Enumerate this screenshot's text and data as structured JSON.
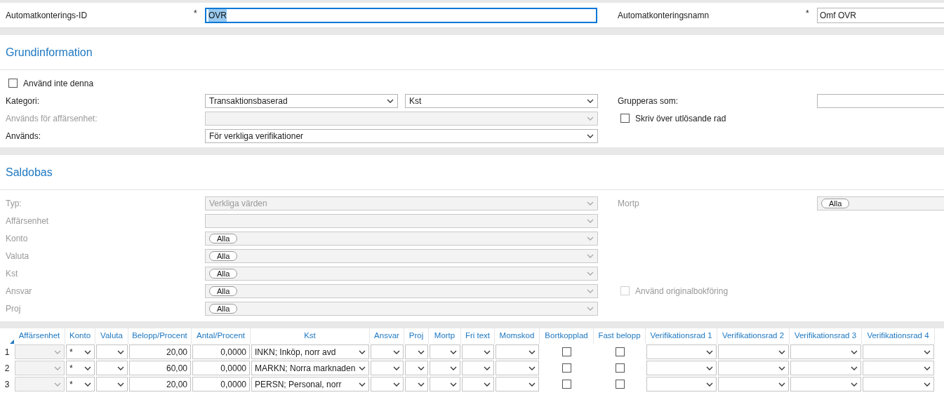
{
  "header": {
    "fields": [
      {
        "label": "Automatkonterings-ID",
        "required": "*",
        "value": "OVR",
        "focused": true
      },
      {
        "label": "Automatkonteringsnamn",
        "required": "*",
        "value": "Omf OVR",
        "focused": false
      }
    ]
  },
  "sections": [
    {
      "title": "Grundinformation",
      "rows": [
        {
          "kind": "checkbox",
          "label": "Använd inte denna",
          "checked": false,
          "disabled": false
        },
        {
          "kind": "selects",
          "label": "Kategori:",
          "disabled": false,
          "selects": [
            {
              "kind": "text",
              "value": "Transaktionsbaserad"
            },
            {
              "kind": "text",
              "value": "Kst"
            }
          ],
          "right": {
            "kind": "input",
            "label": "Grupperas som:",
            "disabled": false
          }
        },
        {
          "kind": "selects",
          "label": "Används för affärsenhet:",
          "disabled": true,
          "selects": [
            {
              "kind": "empty"
            }
          ],
          "right": {
            "kind": "checkbox",
            "label": "Skriv över utlösande rad",
            "checked": false,
            "disabled": false
          }
        },
        {
          "kind": "selects",
          "label": "Används:",
          "disabled": false,
          "selects": [
            {
              "kind": "text",
              "value": "För verkliga verifikationer"
            }
          ]
        }
      ]
    },
    {
      "title": "Saldobas",
      "rows": [
        {
          "kind": "selects",
          "label": "Typ:",
          "disabled": true,
          "selects": [
            {
              "kind": "text",
              "value": "Verkliga värden"
            }
          ],
          "right": {
            "kind": "tags",
            "label": "Mortp",
            "disabled": true,
            "tag": "Alla"
          }
        },
        {
          "kind": "selects",
          "label": "Affärsenhet",
          "disabled": true,
          "selects": [
            {
              "kind": "empty"
            }
          ]
        },
        {
          "kind": "selects",
          "label": "Konto",
          "disabled": true,
          "selects": [
            {
              "kind": "tag",
              "tag": "Alla"
            }
          ]
        },
        {
          "kind": "selects",
          "label": "Valuta",
          "disabled": true,
          "selects": [
            {
              "kind": "tag",
              "tag": "Alla"
            }
          ]
        },
        {
          "kind": "selects",
          "label": "Kst",
          "disabled": true,
          "selects": [
            {
              "kind": "tag",
              "tag": "Alla"
            }
          ]
        },
        {
          "kind": "selects",
          "label": "Ansvar",
          "disabled": true,
          "selects": [
            {
              "kind": "tag",
              "tag": "Alla"
            }
          ],
          "right": {
            "kind": "checkbox",
            "label": "Använd originalbokföring",
            "checked": false,
            "disabled": true
          }
        },
        {
          "kind": "selects",
          "label": "Proj",
          "disabled": true,
          "selects": [
            {
              "kind": "tag",
              "tag": "Alla"
            }
          ]
        }
      ]
    }
  ],
  "table": {
    "columns": [
      {
        "label": "Affärsenhet",
        "kind": "select",
        "disabled": true
      },
      {
        "label": "Konto",
        "kind": "select",
        "disabled": false
      },
      {
        "label": "Valuta",
        "kind": "select",
        "disabled": false
      },
      {
        "label": "Belopp/Procent",
        "kind": "number",
        "disabled": false
      },
      {
        "label": "Antal/Procent",
        "kind": "number",
        "disabled": false
      },
      {
        "label": "Kst",
        "kind": "select",
        "disabled": false
      },
      {
        "label": "Ansvar",
        "kind": "select",
        "disabled": false
      },
      {
        "label": "Proj",
        "kind": "select",
        "disabled": false
      },
      {
        "label": "Mortp",
        "kind": "select",
        "disabled": false
      },
      {
        "label": "Fri text",
        "kind": "select",
        "disabled": false
      },
      {
        "label": "Momskod",
        "kind": "select",
        "disabled": false
      },
      {
        "label": "Bortkopplad",
        "kind": "check",
        "disabled": false
      },
      {
        "label": "Fast belopp",
        "kind": "check",
        "disabled": false
      },
      {
        "label": "Verifikationsrad 1",
        "kind": "select",
        "disabled": false
      },
      {
        "label": "Verifikationsrad 2",
        "kind": "select",
        "disabled": false
      },
      {
        "label": "Verifikationsrad 3",
        "kind": "select",
        "disabled": false
      },
      {
        "label": "Verifikationsrad 4",
        "kind": "select",
        "disabled": false
      }
    ],
    "rows": [
      {
        "number": "1",
        "cells": [
          {},
          {
            "value": "*"
          },
          {},
          {
            "value": "20,00"
          },
          {
            "value": "0,0000"
          },
          {
            "value": "INKN; Inköp, norr avd"
          },
          {},
          {},
          {},
          {},
          {},
          {
            "checked": false
          },
          {
            "checked": false
          },
          {},
          {},
          {},
          {}
        ]
      },
      {
        "number": "2",
        "cells": [
          {},
          {
            "value": "*"
          },
          {},
          {
            "value": "60,00"
          },
          {
            "value": "0,0000"
          },
          {
            "value": "MARKN; Norra marknaden"
          },
          {},
          {},
          {},
          {},
          {},
          {
            "checked": false
          },
          {
            "checked": false
          },
          {},
          {},
          {},
          {}
        ]
      },
      {
        "number": "3",
        "cells": [
          {},
          {
            "value": "*"
          },
          {},
          {
            "value": "20,00"
          },
          {
            "value": "0,0000"
          },
          {
            "value": "PERSN; Personal, norr"
          },
          {},
          {},
          {},
          {},
          {},
          {
            "checked": false
          },
          {
            "checked": false
          },
          {},
          {},
          {},
          {}
        ]
      }
    ]
  }
}
